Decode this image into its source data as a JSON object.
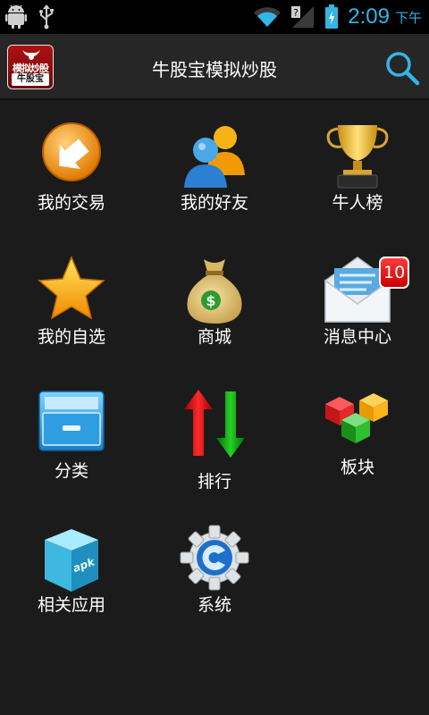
{
  "status_bar": {
    "time": "2:09",
    "ampm": "下午",
    "icons": [
      "android-icon",
      "usb-icon",
      "wifi-icon",
      "signal-icon",
      "battery-icon"
    ]
  },
  "header": {
    "title": "牛股宝模拟炒股",
    "logo_top_text": "模拟炒股",
    "logo_bottom_text": "牛股宝"
  },
  "grid": {
    "items": [
      {
        "label": "我的交易",
        "icon": "trade-arrow-icon"
      },
      {
        "label": "我的好友",
        "icon": "friends-icon"
      },
      {
        "label": "牛人榜",
        "icon": "trophy-icon"
      },
      {
        "label": "我的自选",
        "icon": "star-icon"
      },
      {
        "label": "商城",
        "icon": "money-bag-icon"
      },
      {
        "label": "消息中心",
        "icon": "message-envelope-icon",
        "badge": "10"
      },
      {
        "label": "分类",
        "icon": "drawer-icon"
      },
      {
        "label": "排行",
        "icon": "up-down-arrows-icon"
      },
      {
        "label": "板块",
        "icon": "blocks-icon"
      },
      {
        "label": "相关应用",
        "icon": "apk-box-icon"
      },
      {
        "label": "系统",
        "icon": "settings-gear-icon"
      }
    ]
  },
  "colors": {
    "accent": "#33b5e5",
    "background": "#1b1b1b",
    "title_bar": "#262626",
    "badge": "#e00000"
  }
}
